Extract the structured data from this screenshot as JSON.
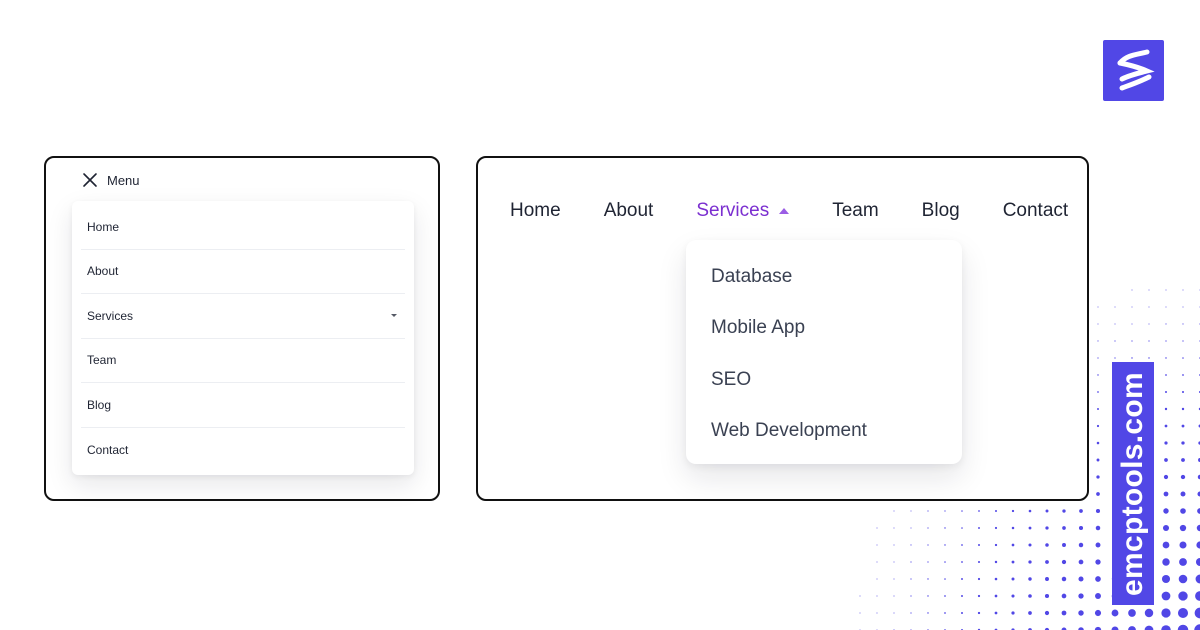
{
  "brand": {
    "logo_icon": "stacked-waves-logo",
    "domain": "emcptools.com",
    "accent_color": "#5147e6"
  },
  "mobile_menu": {
    "toggle_label": "Menu",
    "toggle_icon": "close-icon",
    "items": [
      {
        "label": "Home"
      },
      {
        "label": "About"
      },
      {
        "label": "Services",
        "icon": "chevron-down-icon"
      },
      {
        "label": "Team"
      },
      {
        "label": "Blog"
      },
      {
        "label": "Contact"
      }
    ]
  },
  "desktop_menu": {
    "items": [
      {
        "label": "Home"
      },
      {
        "label": "About"
      },
      {
        "label": "Services",
        "active": true,
        "icon": "chevron-up-icon"
      },
      {
        "label": "Team"
      },
      {
        "label": "Blog"
      },
      {
        "label": "Contact"
      }
    ],
    "active_color": "#7b2fd0",
    "dropdown": {
      "items": [
        {
          "label": "Database"
        },
        {
          "label": "Mobile App"
        },
        {
          "label": "SEO"
        },
        {
          "label": "Web Development"
        }
      ]
    }
  }
}
